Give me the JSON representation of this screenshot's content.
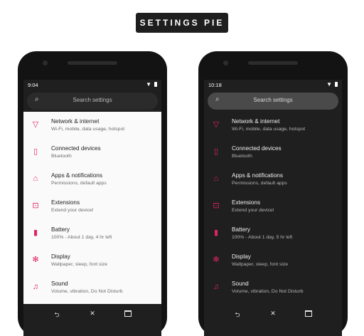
{
  "badge": {
    "title": "SETTINGS PIE"
  },
  "colors": {
    "accent": "#e0245e",
    "light_list_bg": "#fafafa",
    "dark_list_bg": "#1f1f1f"
  },
  "phones": {
    "light": {
      "time": "9:04",
      "search_placeholder": "Search settings",
      "items": [
        {
          "icon": "network-icon",
          "title": "Network & internet",
          "subtitle": "Wi-Fi, mobile, data usage, hotspot"
        },
        {
          "icon": "devices-icon",
          "title": "Connected devices",
          "subtitle": "Bluetooth"
        },
        {
          "icon": "apps-icon",
          "title": "Apps & notifications",
          "subtitle": "Permissions, default apps"
        },
        {
          "icon": "extensions-icon",
          "title": "Extensions",
          "subtitle": "Extend your device!"
        },
        {
          "icon": "battery-icon",
          "title": "Battery",
          "subtitle": "100% - About 1 day, 4 hr left"
        },
        {
          "icon": "display-icon",
          "title": "Display",
          "subtitle": "Wallpaper, sleep, font size"
        },
        {
          "icon": "sound-icon",
          "title": "Sound",
          "subtitle": "Volume, vibration, Do Not Disturb"
        }
      ]
    },
    "dark": {
      "time": "10:18",
      "search_placeholder": "Search settings",
      "items": [
        {
          "icon": "network-icon",
          "title": "Network & internet",
          "subtitle": "Wi-Fi, mobile, data usage, hotspot"
        },
        {
          "icon": "devices-icon",
          "title": "Connected devices",
          "subtitle": "Bluetooth"
        },
        {
          "icon": "apps-icon",
          "title": "Apps & notifications",
          "subtitle": "Permissions, default apps"
        },
        {
          "icon": "extensions-icon",
          "title": "Extensions",
          "subtitle": "Extend your device!"
        },
        {
          "icon": "battery-icon",
          "title": "Battery",
          "subtitle": "100% - About 1 day, 5 hr left"
        },
        {
          "icon": "display-icon",
          "title": "Display",
          "subtitle": "Wallpaper, sleep, font size"
        },
        {
          "icon": "sound-icon",
          "title": "Sound",
          "subtitle": "Volume, vibration, Do Not Disturb"
        }
      ]
    }
  }
}
